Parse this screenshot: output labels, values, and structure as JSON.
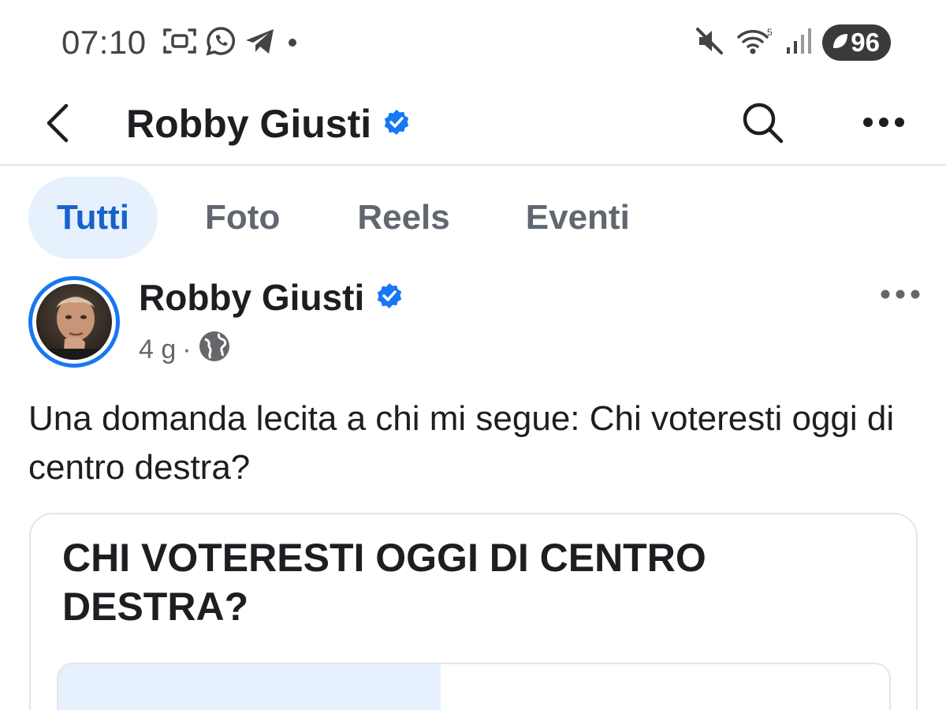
{
  "status_bar": {
    "time": "07:10",
    "left_icons": [
      "screenshot-icon",
      "whatsapp-icon",
      "telegram-icon",
      "notification-dot-icon"
    ],
    "right_icons": [
      "mute-icon",
      "wifi-icon",
      "signal-icon"
    ],
    "battery_level": "96"
  },
  "header": {
    "title": "Robby Giusti",
    "verified": true,
    "icons": [
      "back-arrow-icon",
      "verified-badge-icon",
      "search-icon",
      "more-options-icon"
    ]
  },
  "tabs": [
    {
      "label": "Tutti",
      "active": true
    },
    {
      "label": "Foto",
      "active": false
    },
    {
      "label": "Reels",
      "active": false
    },
    {
      "label": "Eventi",
      "active": false
    }
  ],
  "post": {
    "author": "Robby Giusti",
    "verified": true,
    "time_ago": "4 g",
    "separator": "·",
    "audience_icon": "globe-icon",
    "text": "Una domanda lecita a chi mi segue: Chi voteresti oggi di centro destra?",
    "poll": {
      "question": "CHI VOTERESTI OGGI DI CENTRO DESTRA?",
      "first_option_fill_fraction": 0.46
    }
  },
  "colors": {
    "accent_blue": "#1877f2",
    "active_tab_bg": "#e7f0fd",
    "active_tab_text": "#1663c9",
    "muted_text": "#65676b"
  }
}
